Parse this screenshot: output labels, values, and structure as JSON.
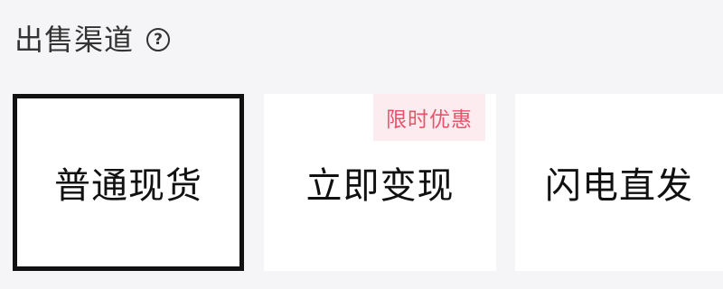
{
  "channel": {
    "title": "出售渠道",
    "help_icon_glyph": "?",
    "options": [
      {
        "label": "普通现货",
        "selected": true
      },
      {
        "label": "立即变现",
        "selected": false,
        "badge": "限时优惠"
      },
      {
        "label": "闪电直发",
        "selected": false
      }
    ]
  },
  "colors": {
    "background": "#f5f5f7",
    "card": "#ffffff",
    "selected_border": "#111111",
    "badge_bg": "#fdecef",
    "badge_text": "#e8536b"
  }
}
